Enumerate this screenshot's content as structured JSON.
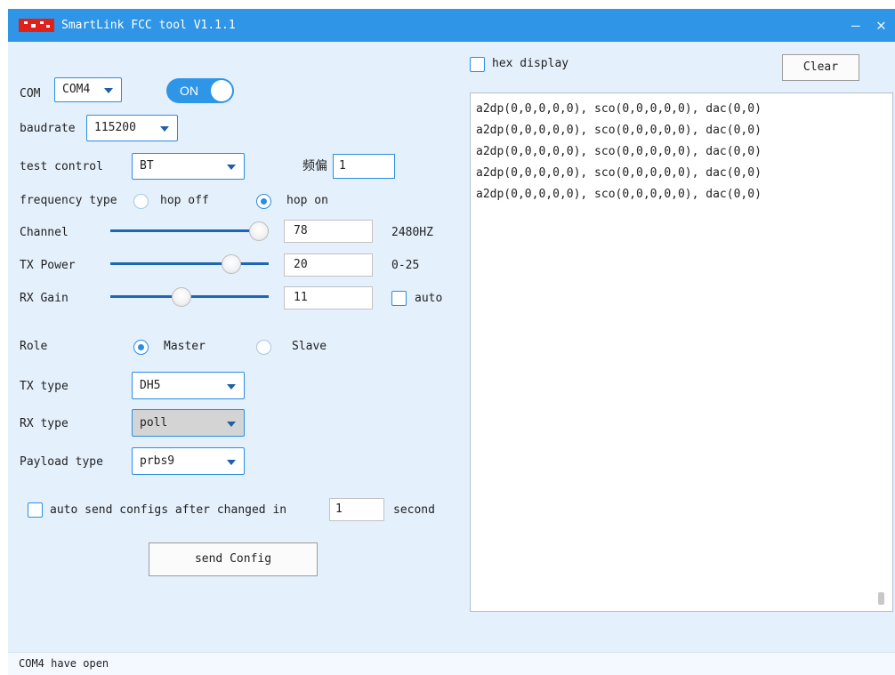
{
  "window": {
    "title": "SmartLink FCC tool V1.1.1",
    "minimize_glyph": "—",
    "close_glyph": "✕",
    "logo_icon": "red-pixel-logo-icon"
  },
  "com": {
    "label": "COM",
    "port": "COM4",
    "toggle_label": "ON",
    "toggle_on": true
  },
  "baudrate": {
    "label": "baudrate",
    "value": "115200"
  },
  "test_control": {
    "label": "test control",
    "value": "BT",
    "freq_offset_label": "频偏",
    "freq_offset_value": "1"
  },
  "frequency_type": {
    "label": "frequency type",
    "options": [
      "hop off",
      "hop on"
    ],
    "selected": "hop on"
  },
  "channel": {
    "label": "Channel",
    "value": "78",
    "slider_fraction": 1.0,
    "unit_text": "2480HZ"
  },
  "tx_power": {
    "label": "TX Power",
    "value": "20",
    "slider_fraction": 0.8,
    "range_text": "0-25"
  },
  "rx_gain": {
    "label": "RX Gain",
    "value": "11",
    "slider_fraction": 0.44,
    "auto_label": "auto",
    "auto_checked": false
  },
  "role": {
    "label": "Role",
    "options": [
      "Master",
      "Slave"
    ],
    "selected": "Master"
  },
  "tx_type": {
    "label": "TX type",
    "value": "DH5"
  },
  "rx_type": {
    "label": "RX type",
    "value": "poll"
  },
  "payload_type": {
    "label": "Payload type",
    "value": "prbs9"
  },
  "auto_send": {
    "label": "auto send configs after changed in",
    "value": "1",
    "unit": "second",
    "checked": false
  },
  "send_button": {
    "label": "send Config"
  },
  "log": {
    "hex_display_label": "hex display",
    "hex_display_checked": false,
    "clear_label": "Clear",
    "lines": [
      "a2dp(0,0,0,0,0), sco(0,0,0,0,0), dac(0,0)",
      "a2dp(0,0,0,0,0), sco(0,0,0,0,0), dac(0,0)",
      "a2dp(0,0,0,0,0), sco(0,0,0,0,0), dac(0,0)",
      "a2dp(0,0,0,0,0), sco(0,0,0,0,0), dac(0,0)",
      "a2dp(0,0,0,0,0), sco(0,0,0,0,0), dac(0,0)"
    ]
  },
  "status": {
    "text": "COM4 have open"
  },
  "colors": {
    "titlebar": "#2f95e6",
    "client_bg": "#e4f0fc",
    "accent": "#2b8de3",
    "slider_track": "#1f65b6"
  }
}
